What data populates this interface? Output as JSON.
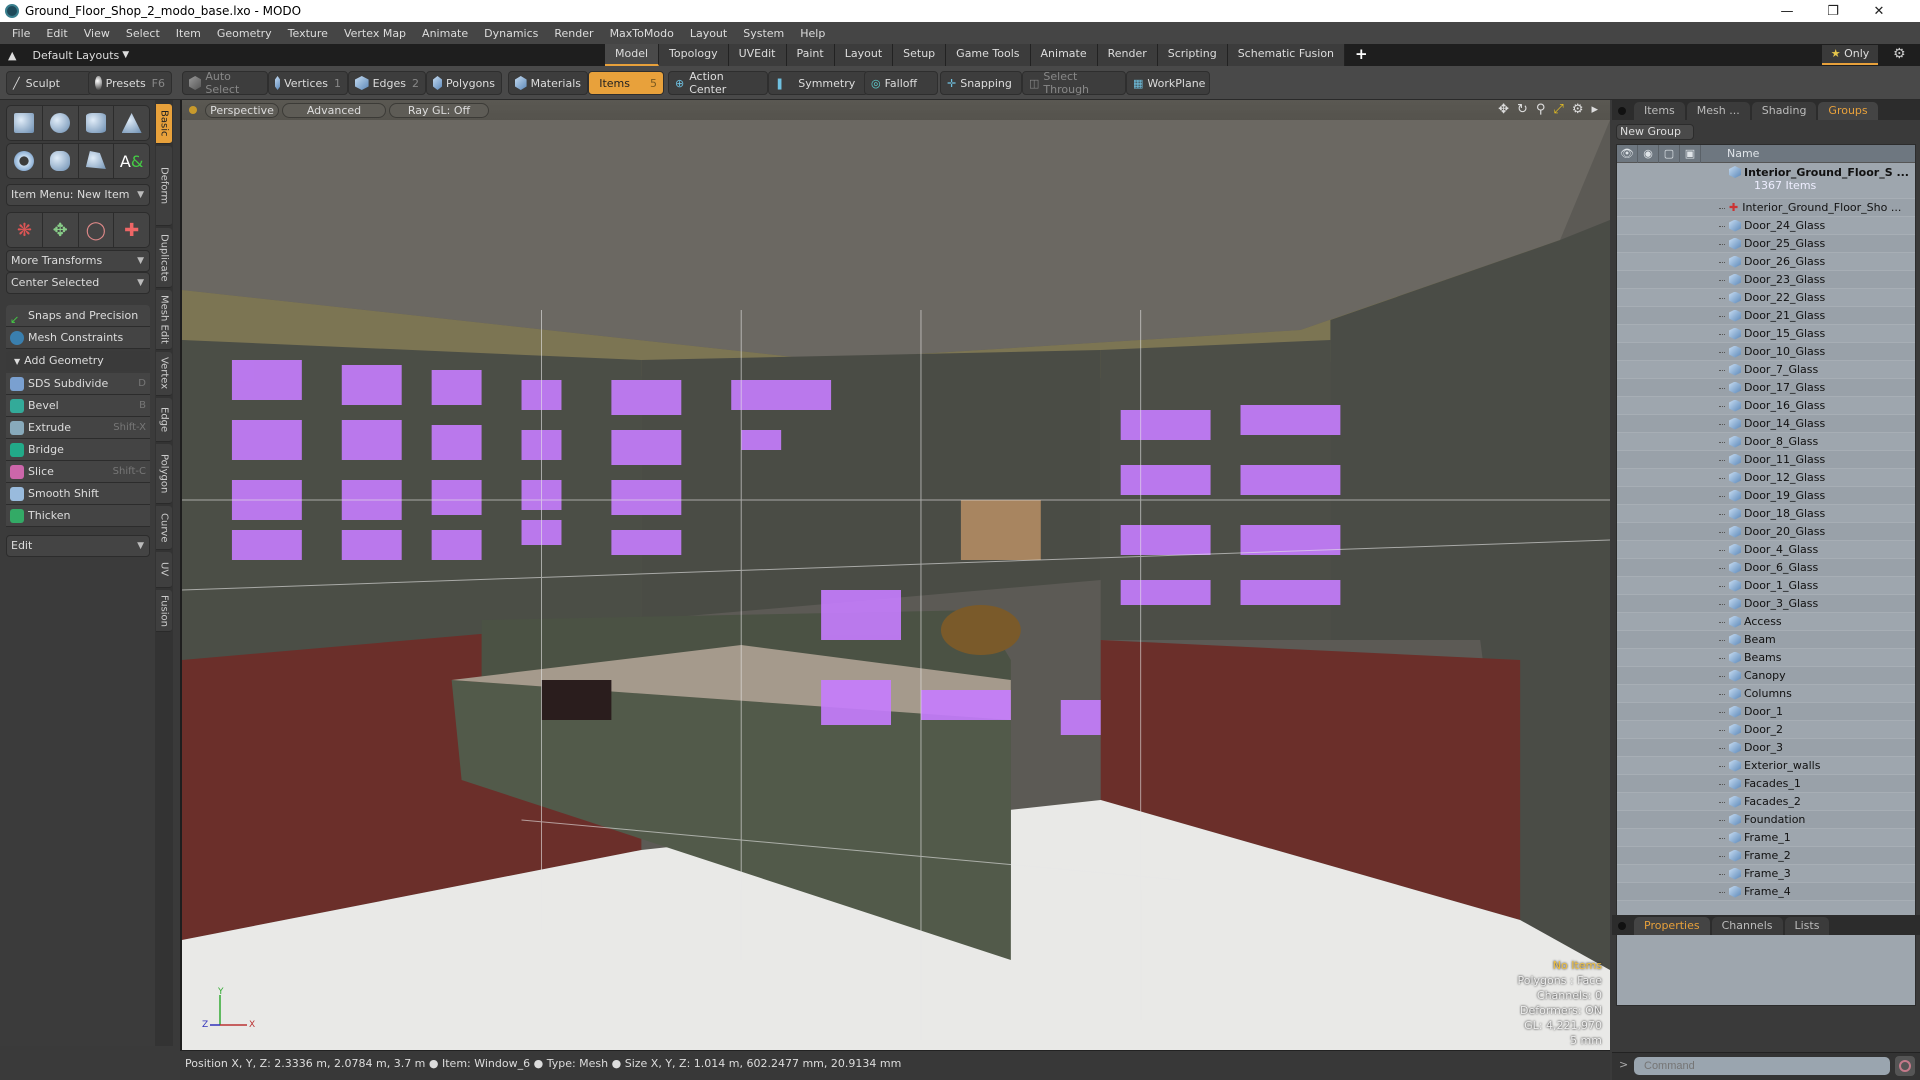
{
  "window": {
    "title": "Ground_Floor_Shop_2_modo_base.lxo - MODO",
    "controls": [
      "minimize",
      "restore",
      "close"
    ]
  },
  "menu": [
    "File",
    "Edit",
    "View",
    "Select",
    "Item",
    "Geometry",
    "Texture",
    "Vertex Map",
    "Animate",
    "Dynamics",
    "Render",
    "MaxToModo",
    "Layout",
    "System",
    "Help"
  ],
  "layout_bar": {
    "layouts_label": "Default Layouts",
    "tabs": [
      "Model",
      "Topology",
      "UVEdit",
      "Paint",
      "Layout",
      "Setup",
      "Game Tools",
      "Animate",
      "Render",
      "Scripting",
      "Schematic Fusion"
    ],
    "active_tab": "Model",
    "only_label": "Only"
  },
  "toolbar": {
    "sculpt": "Sculpt",
    "presets": "Presets",
    "presets_key": "F6",
    "auto_select": "Auto Select",
    "vertices": "Vertices",
    "vertices_key": "1",
    "edges": "Edges",
    "edges_key": "2",
    "polygons": "Polygons",
    "materials": "Materials",
    "items": "Items",
    "items_key": "5",
    "action_center": "Action Center",
    "symmetry": "Symmetry",
    "falloff": "Falloff",
    "snapping": "Snapping",
    "select_through": "Select Through",
    "workplane": "WorkPlane"
  },
  "left_panel": {
    "item_menu": "Item Menu: New Item",
    "more_transforms": "More Transforms",
    "center_selected": "Center Selected",
    "snaps": "Snaps and Precision",
    "mesh_constraints": "Mesh Constraints",
    "add_geometry": "Add Geometry",
    "tools": [
      {
        "label": "SDS Subdivide",
        "shortcut": "D"
      },
      {
        "label": "Bevel",
        "shortcut": "B"
      },
      {
        "label": "Extrude",
        "shortcut": "Shift-X"
      },
      {
        "label": "Bridge",
        "shortcut": ""
      },
      {
        "label": "Slice",
        "shortcut": "Shift-C"
      },
      {
        "label": "Smooth Shift",
        "shortcut": ""
      },
      {
        "label": "Thicken",
        "shortcut": ""
      }
    ],
    "edit_dropdown": "Edit",
    "vertical_tabs": [
      "Basic",
      "Deform",
      "Duplicate",
      "Mesh Edit",
      "Vertex",
      "Edge",
      "Polygon",
      "Curve",
      "UV",
      "Fusion"
    ]
  },
  "viewport": {
    "view": "Perspective",
    "shading": "Advanced",
    "raygl": "Ray GL: Off",
    "info": {
      "selection": "No Items",
      "polygons": "Polygons : Face",
      "channels": "Channels: 0",
      "deformers": "Deformers: ON",
      "gl": "GL: 4,221,970",
      "scale": "5 mm"
    },
    "axis": {
      "x": "X",
      "y": "Y",
      "z": "Z"
    }
  },
  "right_panel": {
    "tabs": [
      "Items",
      "Mesh ...",
      "Shading",
      "Groups"
    ],
    "active_tab": "Groups",
    "new_group": "New Group",
    "column_name": "Name",
    "group_name": "Interior_Ground_Floor_S ...",
    "group_count": "1367 Items",
    "locator": "Interior_Ground_Floor_Sho ...",
    "items": [
      "Door_24_Glass",
      "Door_25_Glass",
      "Door_26_Glass",
      "Door_23_Glass",
      "Door_22_Glass",
      "Door_21_Glass",
      "Door_15_Glass",
      "Door_10_Glass",
      "Door_7_Glass",
      "Door_17_Glass",
      "Door_16_Glass",
      "Door_14_Glass",
      "Door_8_Glass",
      "Door_11_Glass",
      "Door_12_Glass",
      "Door_19_Glass",
      "Door_18_Glass",
      "Door_20_Glass",
      "Door_4_Glass",
      "Door_6_Glass",
      "Door_1_Glass",
      "Door_3_Glass",
      "Access",
      "Beam",
      "Beams",
      "Canopy",
      "Columns",
      "Door_1",
      "Door_2",
      "Door_3",
      "Exterior_walls",
      "Facades_1",
      "Facades_2",
      "Foundation",
      "Frame_1",
      "Frame_2",
      "Frame_3",
      "Frame_4"
    ],
    "bottom_tabs": [
      "Properties",
      "Channels",
      "Lists"
    ],
    "bottom_active": "Properties",
    "command_placeholder": "Command"
  },
  "status": {
    "text": "Position X, Y, Z:   2.3336 m, 2.0784 m, 3.7 m ●  Item:  Window_6 ●  Type:  Mesh ●  Size X, Y, Z:   1.014 m, 602.2477 mm, 20.9134 mm"
  },
  "colors": {
    "accent": "#e8a13b",
    "selection": "#c77dff"
  }
}
